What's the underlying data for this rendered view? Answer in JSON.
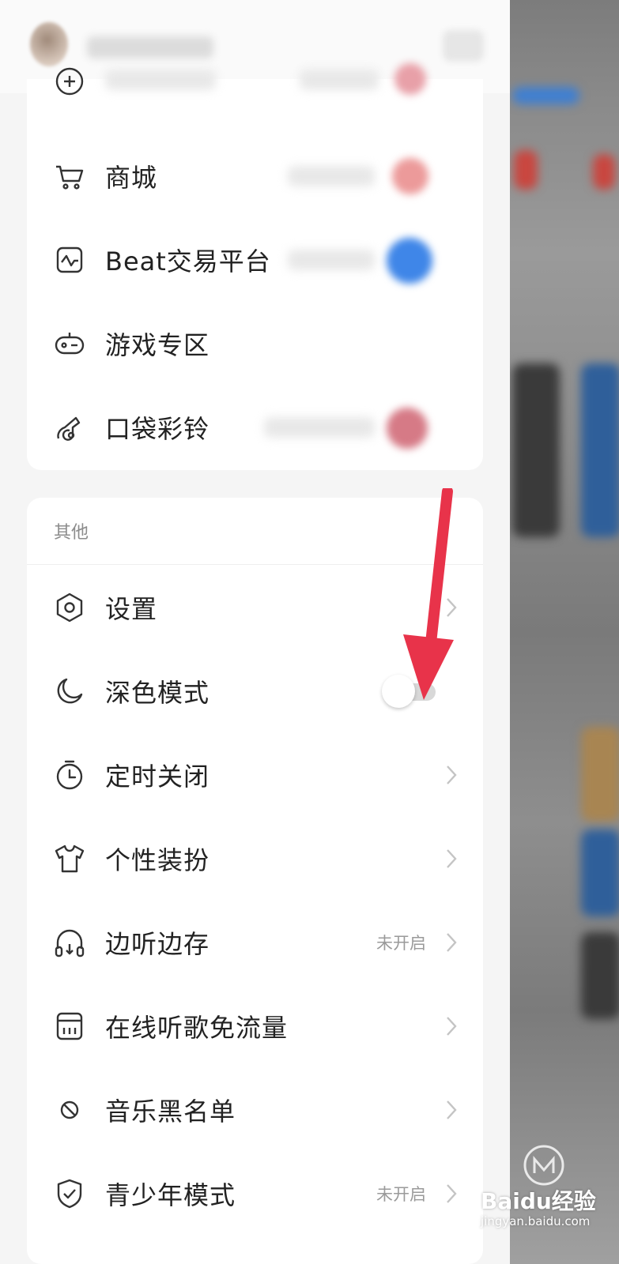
{
  "top_menu": {
    "items": [
      {
        "label": "商城",
        "icon": "cart-icon"
      },
      {
        "label": "Beat交易平台",
        "icon": "beat-icon"
      },
      {
        "label": "游戏专区",
        "icon": "gamepad-icon"
      },
      {
        "label": "口袋彩铃",
        "icon": "ringtone-icon"
      }
    ]
  },
  "other_section": {
    "title": "其他",
    "items": [
      {
        "label": "设置",
        "icon": "settings-hex-icon",
        "status": ""
      },
      {
        "label": "深色模式",
        "icon": "moon-icon",
        "status": "",
        "toggle_on": false
      },
      {
        "label": "定时关闭",
        "icon": "timer-icon",
        "status": ""
      },
      {
        "label": "个性装扮",
        "icon": "tshirt-icon",
        "status": ""
      },
      {
        "label": "边听边存",
        "icon": "headphones-download-icon",
        "status": "未开启"
      },
      {
        "label": "在线听歌免流量",
        "icon": "data-card-icon",
        "status": ""
      },
      {
        "label": "音乐黑名单",
        "icon": "block-icon",
        "status": ""
      },
      {
        "label": "青少年模式",
        "icon": "shield-check-icon",
        "status": "未开启"
      }
    ]
  },
  "watermark": {
    "text": "Baidu经验",
    "url": "jingyan.baidu.com"
  },
  "colors": {
    "arrow": "#e8334a",
    "card": "#ffffff",
    "background": "#f5f5f5",
    "text": "#222222",
    "muted": "#9a9a9a"
  }
}
